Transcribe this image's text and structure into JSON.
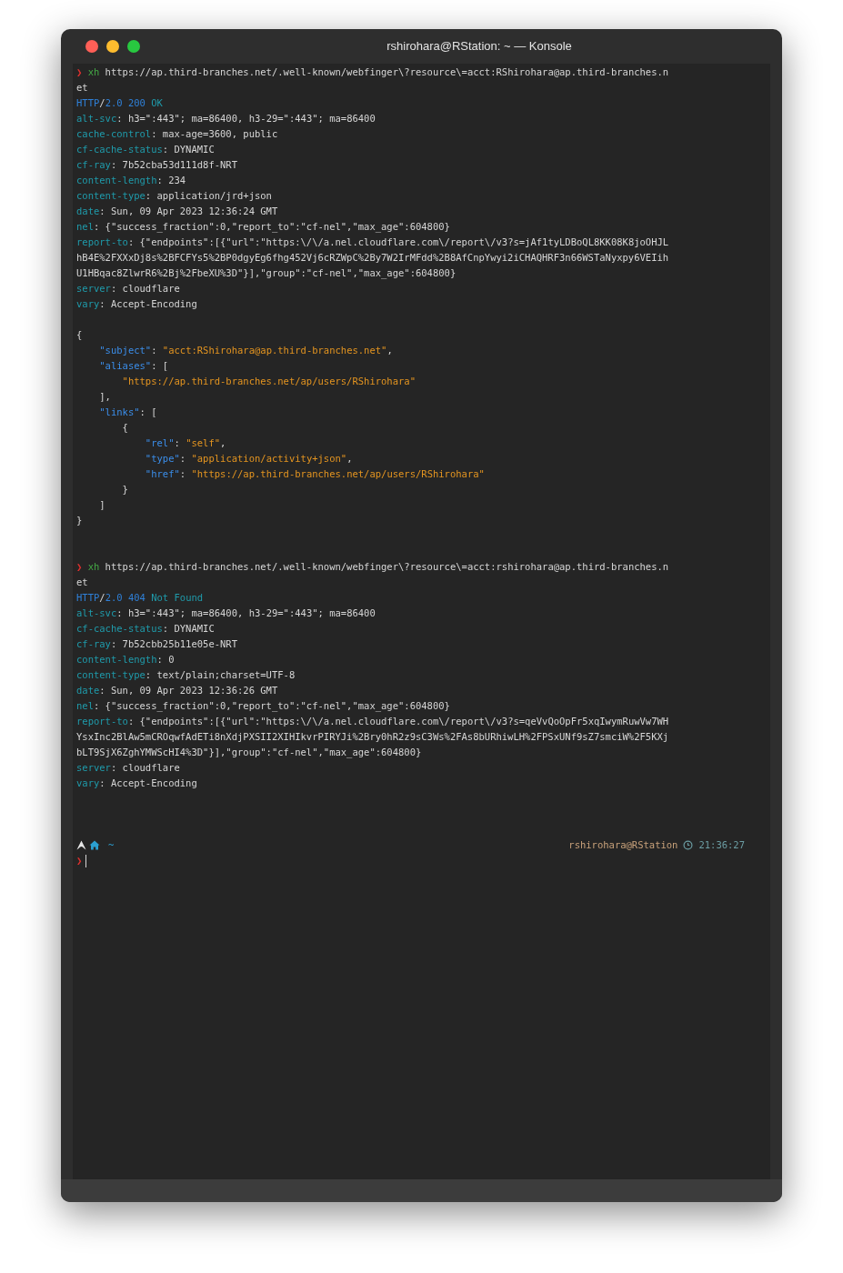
{
  "window": {
    "title": "rshirohara@RStation: ~ — Konsole"
  },
  "terminal": {
    "lines": [
      {
        "kind": "text",
        "spans": [
          {
            "kind": "prompt",
            "text": "❯"
          },
          {
            "kind": "command",
            "text": " xh"
          },
          {
            "kind": "text",
            "text": " https://ap.third-branches.net/.well-known/webfinger\\?resource\\=acct:RShirohara@ap.third-branches.n"
          }
        ]
      },
      {
        "kind": "text",
        "spans": [
          {
            "kind": "text",
            "text": "et"
          }
        ]
      },
      {
        "kind": "text",
        "spans": [
          {
            "kind": "protocol",
            "text": "HTTP"
          },
          {
            "kind": "text",
            "text": "/"
          },
          {
            "kind": "protocol",
            "text": "2.0 200"
          },
          {
            "kind": "reason",
            "text": " OK"
          }
        ]
      },
      {
        "kind": "text",
        "spans": [
          {
            "kind": "key",
            "text": "alt-svc"
          },
          {
            "kind": "text",
            "text": ": h3=\":443\"; ma=86400, h3-29=\":443\"; ma=86400"
          }
        ]
      },
      {
        "kind": "text",
        "spans": [
          {
            "kind": "key",
            "text": "cache-control"
          },
          {
            "kind": "text",
            "text": ": max-age=3600, public"
          }
        ]
      },
      {
        "kind": "text",
        "spans": [
          {
            "kind": "key",
            "text": "cf-cache-status"
          },
          {
            "kind": "text",
            "text": ": DYNAMIC"
          }
        ]
      },
      {
        "kind": "text",
        "spans": [
          {
            "kind": "key",
            "text": "cf-ray"
          },
          {
            "kind": "text",
            "text": ": 7b52cba53d111d8f-NRT"
          }
        ]
      },
      {
        "kind": "text",
        "spans": [
          {
            "kind": "key",
            "text": "content-length"
          },
          {
            "kind": "text",
            "text": ": 234"
          }
        ]
      },
      {
        "kind": "text",
        "spans": [
          {
            "kind": "key",
            "text": "content-type"
          },
          {
            "kind": "text",
            "text": ": application/jrd+json"
          }
        ]
      },
      {
        "kind": "text",
        "spans": [
          {
            "kind": "key",
            "text": "date"
          },
          {
            "kind": "text",
            "text": ": Sun, 09 Apr 2023 12:36:24 GMT"
          }
        ]
      },
      {
        "kind": "text",
        "spans": [
          {
            "kind": "key",
            "text": "nel"
          },
          {
            "kind": "text",
            "text": ": {\"success_fraction\":0,\"report_to\":\"cf-nel\",\"max_age\":604800}"
          }
        ]
      },
      {
        "kind": "text",
        "spans": [
          {
            "kind": "key",
            "text": "report-to"
          },
          {
            "kind": "text",
            "text": ": {\"endpoints\":[{\"url\":\"https:\\/\\/a.nel.cloudflare.com\\/report\\/v3?s=jAf1tyLDBoQL8KK08K8joOHJL"
          }
        ]
      },
      {
        "kind": "text",
        "spans": [
          {
            "kind": "text",
            "text": "hB4E%2FXXxDj8s%2BFCFYs5%2BP0dgyEg6fhg452Vj6cRZWpC%2By7W2IrMFdd%2B8AfCnpYwyi2iCHAQHRF3n66WSTaNyxpy6VEIih"
          }
        ]
      },
      {
        "kind": "text",
        "spans": [
          {
            "kind": "text",
            "text": "U1HBqac8ZlwrR6%2Bj%2FbeXU%3D\"}],\"group\":\"cf-nel\",\"max_age\":604800}"
          }
        ]
      },
      {
        "kind": "text",
        "spans": [
          {
            "kind": "key",
            "text": "server"
          },
          {
            "kind": "text",
            "text": ": cloudflare"
          }
        ]
      },
      {
        "kind": "text",
        "spans": [
          {
            "kind": "key",
            "text": "vary"
          },
          {
            "kind": "text",
            "text": ": Accept-Encoding"
          }
        ]
      },
      {
        "kind": "blank"
      },
      {
        "kind": "text",
        "spans": [
          {
            "kind": "text",
            "text": "{"
          }
        ]
      },
      {
        "kind": "text",
        "spans": [
          {
            "kind": "jkey",
            "text": "    \"subject\""
          },
          {
            "kind": "text",
            "text": ": "
          },
          {
            "kind": "jstr",
            "text": "\"acct:RShirohara@ap.third-branches.net\""
          },
          {
            "kind": "text",
            "text": ","
          }
        ]
      },
      {
        "kind": "text",
        "spans": [
          {
            "kind": "jkey",
            "text": "    \"aliases\""
          },
          {
            "kind": "text",
            "text": ": ["
          }
        ]
      },
      {
        "kind": "text",
        "spans": [
          {
            "kind": "jstr",
            "text": "        \"https://ap.third-branches.net/ap/users/RShirohara\""
          }
        ]
      },
      {
        "kind": "text",
        "spans": [
          {
            "kind": "text",
            "text": "    ],"
          }
        ]
      },
      {
        "kind": "text",
        "spans": [
          {
            "kind": "jkey",
            "text": "    \"links\""
          },
          {
            "kind": "text",
            "text": ": ["
          }
        ]
      },
      {
        "kind": "text",
        "spans": [
          {
            "kind": "text",
            "text": "        {"
          }
        ]
      },
      {
        "kind": "text",
        "spans": [
          {
            "kind": "jkey",
            "text": "            \"rel\""
          },
          {
            "kind": "text",
            "text": ": "
          },
          {
            "kind": "jstr",
            "text": "\"self\""
          },
          {
            "kind": "text",
            "text": ","
          }
        ]
      },
      {
        "kind": "text",
        "spans": [
          {
            "kind": "jkey",
            "text": "            \"type\""
          },
          {
            "kind": "text",
            "text": ": "
          },
          {
            "kind": "jstr",
            "text": "\"application/activity+json\""
          },
          {
            "kind": "text",
            "text": ","
          }
        ]
      },
      {
        "kind": "text",
        "spans": [
          {
            "kind": "jkey",
            "text": "            \"href\""
          },
          {
            "kind": "text",
            "text": ": "
          },
          {
            "kind": "jstr",
            "text": "\"https://ap.third-branches.net/ap/users/RShirohara\""
          }
        ]
      },
      {
        "kind": "text",
        "spans": [
          {
            "kind": "text",
            "text": "        }"
          }
        ]
      },
      {
        "kind": "text",
        "spans": [
          {
            "kind": "text",
            "text": "    ]"
          }
        ]
      },
      {
        "kind": "text",
        "spans": [
          {
            "kind": "text",
            "text": "}"
          }
        ]
      },
      {
        "kind": "blank"
      },
      {
        "kind": "blank"
      },
      {
        "kind": "text",
        "spans": [
          {
            "kind": "prompt",
            "text": "❯"
          },
          {
            "kind": "command",
            "text": " xh"
          },
          {
            "kind": "text",
            "text": " https://ap.third-branches.net/.well-known/webfinger\\?resource\\=acct:rshirohara@ap.third-branches.n"
          }
        ]
      },
      {
        "kind": "text",
        "spans": [
          {
            "kind": "text",
            "text": "et"
          }
        ]
      },
      {
        "kind": "text",
        "spans": [
          {
            "kind": "protocol",
            "text": "HTTP"
          },
          {
            "kind": "text",
            "text": "/"
          },
          {
            "kind": "protocol",
            "text": "2.0 404"
          },
          {
            "kind": "reason",
            "text": " Not Found"
          }
        ]
      },
      {
        "kind": "text",
        "spans": [
          {
            "kind": "key",
            "text": "alt-svc"
          },
          {
            "kind": "text",
            "text": ": h3=\":443\"; ma=86400, h3-29=\":443\"; ma=86400"
          }
        ]
      },
      {
        "kind": "text",
        "spans": [
          {
            "kind": "key",
            "text": "cf-cache-status"
          },
          {
            "kind": "text",
            "text": ": DYNAMIC"
          }
        ]
      },
      {
        "kind": "text",
        "spans": [
          {
            "kind": "key",
            "text": "cf-ray"
          },
          {
            "kind": "text",
            "text": ": 7b52cbb25b11e05e-NRT"
          }
        ]
      },
      {
        "kind": "text",
        "spans": [
          {
            "kind": "key",
            "text": "content-length"
          },
          {
            "kind": "text",
            "text": ": 0"
          }
        ]
      },
      {
        "kind": "text",
        "spans": [
          {
            "kind": "key",
            "text": "content-type"
          },
          {
            "kind": "text",
            "text": ": text/plain;charset=UTF-8"
          }
        ]
      },
      {
        "kind": "text",
        "spans": [
          {
            "kind": "key",
            "text": "date"
          },
          {
            "kind": "text",
            "text": ": Sun, 09 Apr 2023 12:36:26 GMT"
          }
        ]
      },
      {
        "kind": "text",
        "spans": [
          {
            "kind": "key",
            "text": "nel"
          },
          {
            "kind": "text",
            "text": ": {\"success_fraction\":0,\"report_to\":\"cf-nel\",\"max_age\":604800}"
          }
        ]
      },
      {
        "kind": "text",
        "spans": [
          {
            "kind": "key",
            "text": "report-to"
          },
          {
            "kind": "text",
            "text": ": {\"endpoints\":[{\"url\":\"https:\\/\\/a.nel.cloudflare.com\\/report\\/v3?s=qeVvQoOpFr5xqIwymRuwVw7WH"
          }
        ]
      },
      {
        "kind": "text",
        "spans": [
          {
            "kind": "text",
            "text": "YsxInc2BlAw5mCROqwfAdETi8nXdjPXSII2XIHIkvrPIRYJi%2Bry0hR2z9sC3Ws%2FAs8bURhiwLH%2FPSxUNf9sZ7smciW%2F5KXj"
          }
        ]
      },
      {
        "kind": "text",
        "spans": [
          {
            "kind": "text",
            "text": "bLT9SjX6ZghYMWScHI4%3D\"}],\"group\":\"cf-nel\",\"max_age\":604800}"
          }
        ]
      },
      {
        "kind": "text",
        "spans": [
          {
            "kind": "key",
            "text": "server"
          },
          {
            "kind": "text",
            "text": ": cloudflare"
          }
        ]
      },
      {
        "kind": "text",
        "spans": [
          {
            "kind": "key",
            "text": "vary"
          },
          {
            "kind": "text",
            "text": ": Accept-Encoding"
          }
        ]
      },
      {
        "kind": "blank"
      },
      {
        "kind": "blank"
      },
      {
        "kind": "blank"
      },
      {
        "kind": "status",
        "dir": "~",
        "host": "rshirohara@RStation",
        "time": "21:36:27"
      },
      {
        "kind": "input",
        "prompt": "❯"
      }
    ]
  }
}
